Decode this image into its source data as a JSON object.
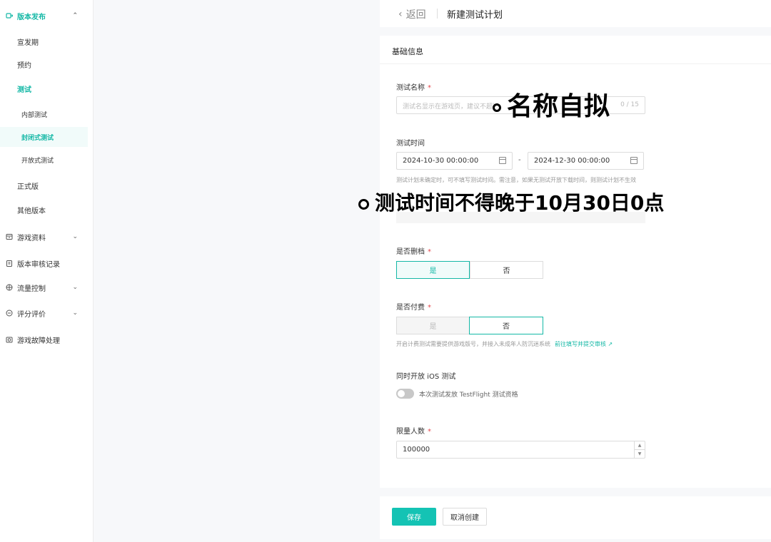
{
  "sidebar": {
    "items": [
      {
        "label": "版本发布"
      },
      {
        "label": "宣发期"
      },
      {
        "label": "预约"
      },
      {
        "label": "测试"
      },
      {
        "label": "内部测试"
      },
      {
        "label": "封闭式测试"
      },
      {
        "label": "开放式测试"
      },
      {
        "label": "正式版"
      },
      {
        "label": "其他版本"
      },
      {
        "label": "游戏资料"
      },
      {
        "label": "版本审核记录"
      },
      {
        "label": "流量控制"
      },
      {
        "label": "评分评价"
      },
      {
        "label": "游戏故障处理"
      }
    ]
  },
  "topbar": {
    "back": "返回",
    "title": "新建测试计划"
  },
  "card": {
    "title": "基础信息"
  },
  "form": {
    "name": {
      "label": "测试名称",
      "req": "*",
      "placeholder": "测试名显示在游戏页，建议不超过",
      "count": "0 / 15"
    },
    "time": {
      "label": "测试时间",
      "start": "2024-10-30 00:00:00",
      "end": "2024-12-30 00:00:00",
      "dash": "-",
      "hint": "测试计划未确定时，可不填写测试时间。需注意，如果无测试开放下载时间，则测试计划不生效"
    },
    "delete": {
      "label": "是否删档",
      "req": "*",
      "yes": "是",
      "no": "否"
    },
    "paid": {
      "label": "是否付费",
      "req": "*",
      "yes": "是",
      "no": "否",
      "hint": "开启计费测试需要提供游戏版号，并接入未成年人防沉迷系统",
      "link": "前往填写并提交审核 ↗"
    },
    "ios": {
      "label": "同时开放 iOS 测试",
      "toggle_label": "本次测试发放 TestFlight 测试资格"
    },
    "limit": {
      "label": "限量人数",
      "req": "*",
      "value": "100000"
    }
  },
  "footer": {
    "save": "保存",
    "cancel": "取消创建"
  },
  "annotations": {
    "a1": "名称自拟",
    "a2": "测试时间不得晚于10月30日0点"
  },
  "colors": {
    "accent": "#14b8a6",
    "required": "#e5484d"
  }
}
